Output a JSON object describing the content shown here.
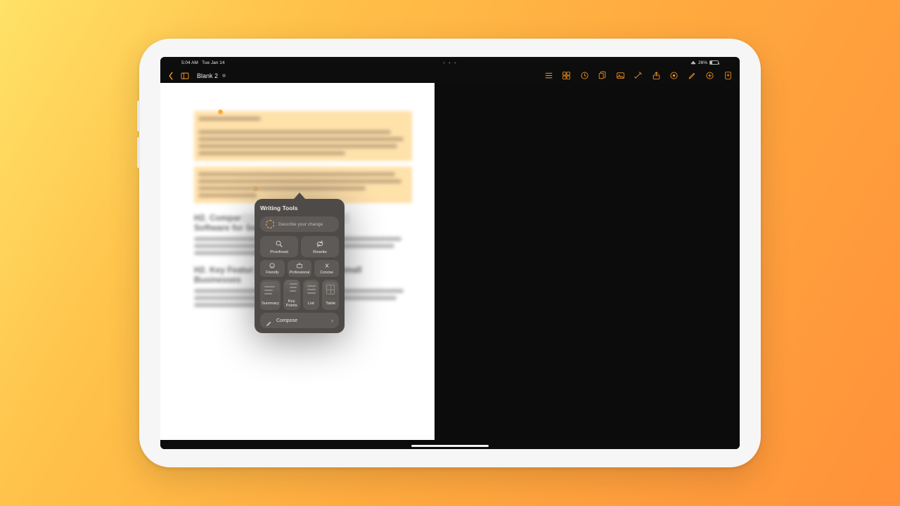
{
  "status": {
    "time": "5:04 AM",
    "date": "Tue Jan 14",
    "dots": "• • •",
    "battery_pct": "26%"
  },
  "toolbar": {
    "doc_title": "Blank 2"
  },
  "popover": {
    "title": "Writing Tools",
    "describe_placeholder": "Describe your change",
    "proofread": "Proofread",
    "rewrite": "Rewrite",
    "friendly": "Friendly",
    "professional": "Professional",
    "concise": "Concise",
    "summary": "Summary",
    "key_points": "Key\nPoints",
    "list": "List",
    "table": "Table",
    "compose": "Compose"
  }
}
